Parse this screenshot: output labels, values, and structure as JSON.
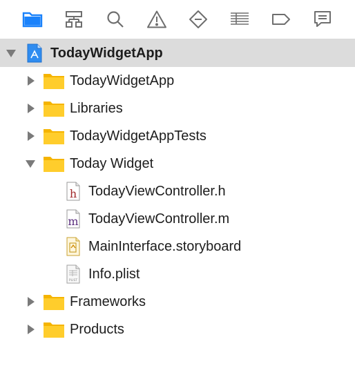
{
  "toolbar": {
    "icons": [
      {
        "name": "folder-icon",
        "active": true
      },
      {
        "name": "hierarchy-icon",
        "active": false
      },
      {
        "name": "search-icon",
        "active": false
      },
      {
        "name": "warning-icon",
        "active": false
      },
      {
        "name": "test-diamond-icon",
        "active": false
      },
      {
        "name": "debug-list-icon",
        "active": false
      },
      {
        "name": "breakpoint-tag-icon",
        "active": false
      },
      {
        "name": "report-bubble-icon",
        "active": false
      }
    ],
    "accent_color": "#1a82fb",
    "icon_color": "#6e6e6e"
  },
  "tree": {
    "project": {
      "label": "TodayWidgetApp",
      "expanded": true,
      "icon": "xcode-project-icon"
    },
    "groups": [
      {
        "label": "TodayWidgetApp",
        "expanded": false,
        "icon": "folder-icon"
      },
      {
        "label": "Libraries",
        "expanded": false,
        "icon": "folder-icon"
      },
      {
        "label": "TodayWidgetAppTests",
        "expanded": false,
        "icon": "folder-icon"
      },
      {
        "label": "Today Widget",
        "expanded": true,
        "icon": "folder-icon"
      },
      {
        "label": "Frameworks",
        "expanded": false,
        "icon": "folder-icon"
      },
      {
        "label": "Products",
        "expanded": false,
        "icon": "folder-icon"
      }
    ],
    "files": [
      {
        "label": "TodayViewController.h",
        "icon": "header-file-icon",
        "glyph": "h"
      },
      {
        "label": "TodayViewController.m",
        "icon": "objc-file-icon",
        "glyph": "m"
      },
      {
        "label": "MainInterface.storyboard",
        "icon": "storyboard-file-icon"
      },
      {
        "label": "Info.plist",
        "icon": "plist-file-icon",
        "glyph": "PLIST"
      }
    ]
  }
}
